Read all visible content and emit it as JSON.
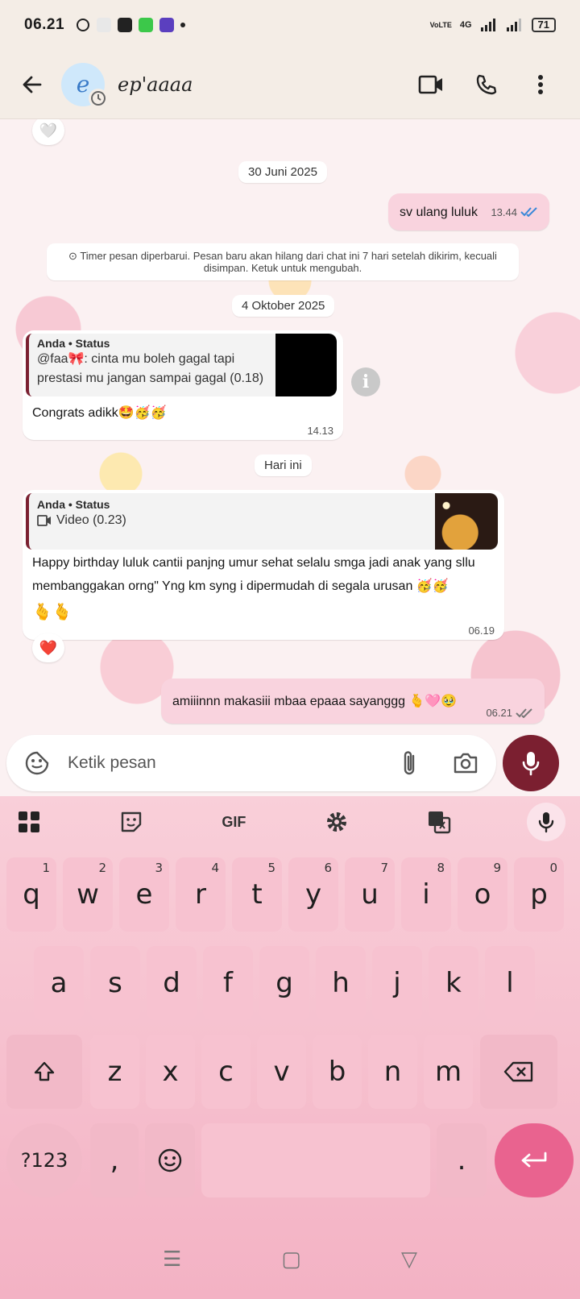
{
  "status_bar": {
    "time": "06.21",
    "network": "4G",
    "volte": "VoLTE",
    "battery": "71"
  },
  "header": {
    "contact_name": "ep'aaaa",
    "avatar_letter": "e"
  },
  "chat": {
    "dates": {
      "date1": "30 Juni 2025",
      "date2": "4 Oktober 2025",
      "date3": "Hari ini"
    },
    "msg_out_1": {
      "text": "sv ulang luluk",
      "time": "13.44"
    },
    "system_notice": "⊙ Timer pesan diperbarui. Pesan baru akan hilang dari chat ini 7 hari setelah dikirim, kecuali disimpan. Ketuk untuk mengubah.",
    "msg_in_1": {
      "quote_author": "Anda • Status",
      "quote_text": "@faa🎀: cinta mu boleh gagal tapi prestasi mu jangan sampai gagal (0.18)",
      "text": "Congrats adikk🤩🥳🥳",
      "time": "14.13"
    },
    "msg_in_2": {
      "quote_author": "Anda • Status",
      "quote_text": "Video (0.23)",
      "text": "Happy birthday luluk cantii panjng umur sehat selalu smga jadi anak yang sllu membanggakan orng\" Yng km syng i dipermudah di segala urusan 🥳🥳",
      "text2": "🫰🫰",
      "time": "06.19",
      "reaction": "❤️"
    },
    "msg_out_2": {
      "text": "amiiinnn makasiii mbaa epaaa sayanggg 🫰🩷🥹",
      "time": "06.21"
    },
    "top_reaction": "🤍"
  },
  "composer": {
    "placeholder": "Ketik pesan"
  },
  "keyboard": {
    "toolbar": {
      "gif_label": "GIF"
    },
    "row1": [
      "q",
      "w",
      "e",
      "r",
      "t",
      "y",
      "u",
      "i",
      "o",
      "p"
    ],
    "row1_hints": [
      "1",
      "2",
      "3",
      "4",
      "5",
      "6",
      "7",
      "8",
      "9",
      "0"
    ],
    "row2": [
      "a",
      "s",
      "d",
      "f",
      "g",
      "h",
      "j",
      "k",
      "l"
    ],
    "row3": [
      "z",
      "x",
      "c",
      "v",
      "b",
      "n",
      "m"
    ],
    "symbols_label": "?123",
    "comma": ",",
    "period": "."
  },
  "navbar": {
    "menu": "☰",
    "home": "▢",
    "back": "▽"
  },
  "colors": {
    "header_bg": "#f4ede6",
    "out_bubble": "#f9d3de",
    "accent": "#7b1f30",
    "keyboard": "#f7c2d0",
    "enter": "#e9638f"
  }
}
